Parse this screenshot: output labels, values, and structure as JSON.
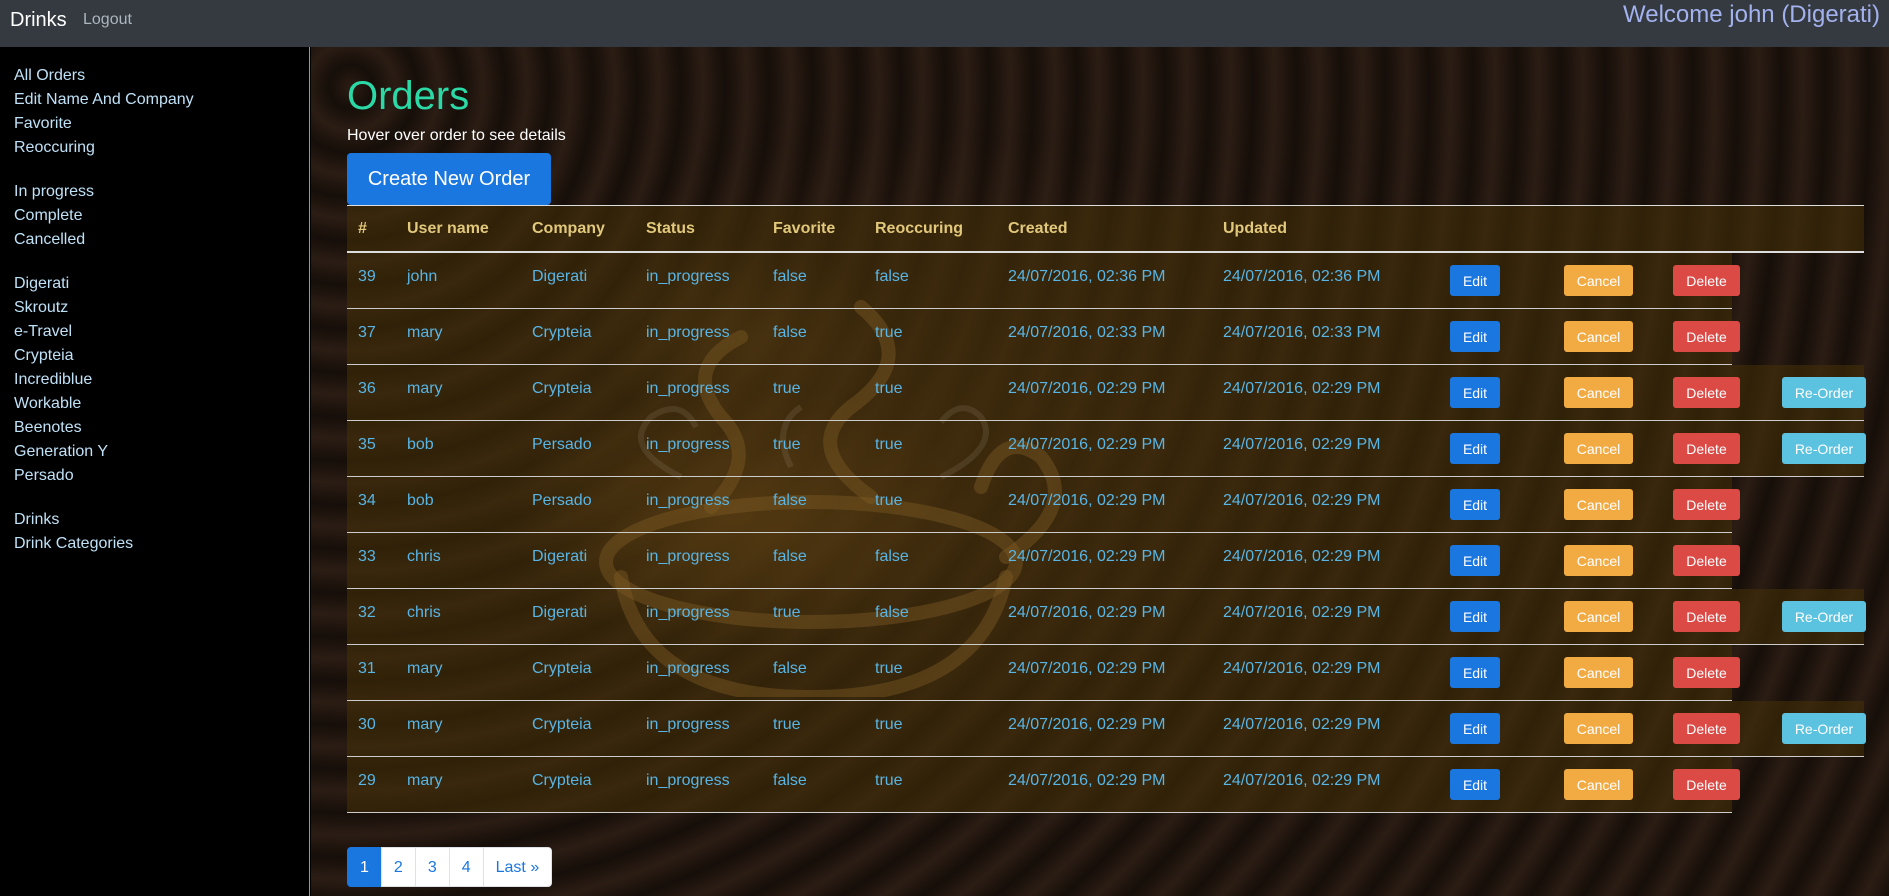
{
  "navbar": {
    "brand": "Drinks",
    "logout": "Logout",
    "welcome": "Welcome john (Digerati)"
  },
  "sidebar": {
    "groups": [
      [
        "All Orders",
        "Edit Name And Company",
        "Favorite",
        "Reoccuring"
      ],
      [
        "In progress",
        "Complete",
        "Cancelled"
      ],
      [
        "Digerati",
        "Skroutz",
        "e-Travel",
        "Crypteia",
        "Incrediblue",
        "Workable",
        "Beenotes",
        "Generation Y",
        "Persado"
      ],
      [
        "Drinks",
        "Drink Categories"
      ]
    ]
  },
  "main": {
    "title": "Orders",
    "hint": "Hover over order to see details",
    "create_button": "Create New Order"
  },
  "table": {
    "headers": [
      "#",
      "User name",
      "Company",
      "Status",
      "Favorite",
      "Reoccuring",
      "Created",
      "Updated"
    ],
    "buttons": {
      "edit": "Edit",
      "cancel": "Cancel",
      "delete": "Delete",
      "reorder": "Re-Order"
    },
    "rows": [
      {
        "id": "39",
        "user": "john",
        "company": "Digerati",
        "status": "in_progress",
        "favorite": "false",
        "reoccuring": "false",
        "created": "24/07/2016, 02:36 PM",
        "updated": "24/07/2016, 02:36 PM",
        "reorder": false
      },
      {
        "id": "37",
        "user": "mary",
        "company": "Crypteia",
        "status": "in_progress",
        "favorite": "false",
        "reoccuring": "true",
        "created": "24/07/2016, 02:33 PM",
        "updated": "24/07/2016, 02:33 PM",
        "reorder": false
      },
      {
        "id": "36",
        "user": "mary",
        "company": "Crypteia",
        "status": "in_progress",
        "favorite": "true",
        "reoccuring": "true",
        "created": "24/07/2016, 02:29 PM",
        "updated": "24/07/2016, 02:29 PM",
        "reorder": true
      },
      {
        "id": "35",
        "user": "bob",
        "company": "Persado",
        "status": "in_progress",
        "favorite": "true",
        "reoccuring": "true",
        "created": "24/07/2016, 02:29 PM",
        "updated": "24/07/2016, 02:29 PM",
        "reorder": true
      },
      {
        "id": "34",
        "user": "bob",
        "company": "Persado",
        "status": "in_progress",
        "favorite": "false",
        "reoccuring": "true",
        "created": "24/07/2016, 02:29 PM",
        "updated": "24/07/2016, 02:29 PM",
        "reorder": false
      },
      {
        "id": "33",
        "user": "chris",
        "company": "Digerati",
        "status": "in_progress",
        "favorite": "false",
        "reoccuring": "false",
        "created": "24/07/2016, 02:29 PM",
        "updated": "24/07/2016, 02:29 PM",
        "reorder": false
      },
      {
        "id": "32",
        "user": "chris",
        "company": "Digerati",
        "status": "in_progress",
        "favorite": "true",
        "reoccuring": "false",
        "created": "24/07/2016, 02:29 PM",
        "updated": "24/07/2016, 02:29 PM",
        "reorder": true
      },
      {
        "id": "31",
        "user": "mary",
        "company": "Crypteia",
        "status": "in_progress",
        "favorite": "false",
        "reoccuring": "true",
        "created": "24/07/2016, 02:29 PM",
        "updated": "24/07/2016, 02:29 PM",
        "reorder": false
      },
      {
        "id": "30",
        "user": "mary",
        "company": "Crypteia",
        "status": "in_progress",
        "favorite": "true",
        "reoccuring": "true",
        "created": "24/07/2016, 02:29 PM",
        "updated": "24/07/2016, 02:29 PM",
        "reorder": true
      },
      {
        "id": "29",
        "user": "mary",
        "company": "Crypteia",
        "status": "in_progress",
        "favorite": "false",
        "reoccuring": "true",
        "created": "24/07/2016, 02:29 PM",
        "updated": "24/07/2016, 02:29 PM",
        "reorder": false
      }
    ]
  },
  "pagination": {
    "pages": [
      "1",
      "2",
      "3",
      "4"
    ],
    "last": "Last »",
    "active": "1"
  }
}
